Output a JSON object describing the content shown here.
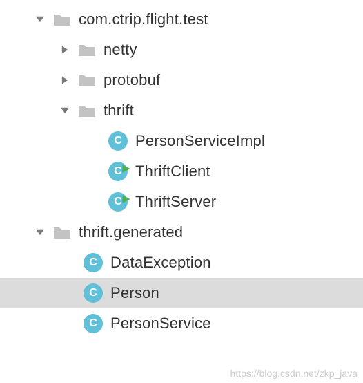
{
  "tree": {
    "root": {
      "label": "com.ctrip.flight.test",
      "children": {
        "netty": {
          "label": "netty"
        },
        "protobuf": {
          "label": "protobuf"
        },
        "thrift": {
          "label": "thrift",
          "children": {
            "personServiceImpl": {
              "label": "PersonServiceImpl"
            },
            "thriftClient": {
              "label": "ThriftClient"
            },
            "thriftServer": {
              "label": "ThriftServer"
            }
          }
        }
      }
    },
    "generated": {
      "label": "thrift.generated",
      "children": {
        "dataException": {
          "label": "DataException"
        },
        "person": {
          "label": "Person"
        },
        "personService": {
          "label": "PersonService"
        }
      }
    }
  },
  "watermark": "https://blog.csdn.net/zkp_java"
}
